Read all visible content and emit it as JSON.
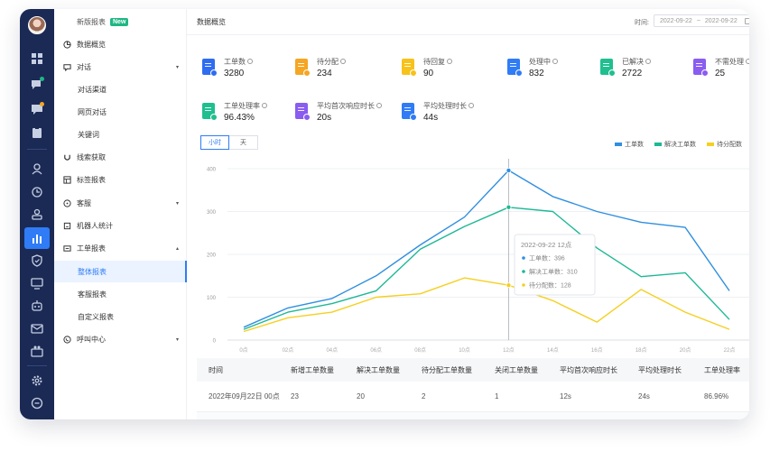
{
  "menu": {
    "report_new": "新版报表",
    "new_badge": "New",
    "items": [
      {
        "label": "数据概览",
        "icon": "pie-chart-icon"
      },
      {
        "label": "对话",
        "icon": "chat-icon",
        "caret": "▾"
      },
      {
        "label": "对话渠道"
      },
      {
        "label": "网页对话"
      },
      {
        "label": "关键词"
      },
      {
        "label": "线索获取",
        "icon": "magnet-icon"
      },
      {
        "label": "标签报表",
        "icon": "tag-table-icon"
      },
      {
        "label": "客服",
        "icon": "headset-icon",
        "caret": "▾"
      },
      {
        "label": "机器人统计",
        "icon": "robot-icon"
      },
      {
        "label": "工单报表",
        "icon": "ticket-icon",
        "caret": "▴"
      },
      {
        "label": "整体报表"
      },
      {
        "label": "客服报表"
      },
      {
        "label": "自定义报表"
      },
      {
        "label": "呼叫中心",
        "icon": "phone-icon",
        "caret": "▾"
      }
    ]
  },
  "header": {
    "title": "数据概览",
    "time_label": "时间:",
    "date_from": "2022-09-22",
    "date_sep": "~",
    "date_to": "2022-09-22"
  },
  "stats": [
    {
      "label": "工单数",
      "value": "3280",
      "color": "#2f6cf0"
    },
    {
      "label": "待分配",
      "value": "234",
      "color": "#f5a623"
    },
    {
      "label": "待回复",
      "value": "90",
      "color": "#f7c21a"
    },
    {
      "label": "处理中",
      "value": "832",
      "color": "#2f7cf6"
    },
    {
      "label": "已解决",
      "value": "2722",
      "color": "#1fbf8f"
    },
    {
      "label": "不需处理",
      "value": "25",
      "color": "#8a5cf0"
    },
    {
      "label": "工单处理率",
      "value": "96.43%",
      "color": "#1fbf8f"
    },
    {
      "label": "平均首次响应时长",
      "value": "20s",
      "color": "#8a5cf0"
    },
    {
      "label": "平均处理时长",
      "value": "44s",
      "color": "#2f7cf6"
    }
  ],
  "toggle": {
    "hour": "小时",
    "day": "天"
  },
  "colors": {
    "accent": "#2f7cf6",
    "series1": "#2f8fe0",
    "series2": "#1db896",
    "series3": "#f5d020"
  },
  "chart_data": {
    "type": "line",
    "x": [
      "0点",
      "02点",
      "04点",
      "06点",
      "08点",
      "10点",
      "12点",
      "14点",
      "16点",
      "18点",
      "20点",
      "22点"
    ],
    "ylim": [
      0,
      400
    ],
    "yticks": [
      0,
      100,
      200,
      300,
      400
    ],
    "legend_position": "top-right",
    "grid": true,
    "series": [
      {
        "name": "工单数",
        "values": [
          30,
          75,
          97,
          150,
          222,
          287,
          396,
          335,
          300,
          275,
          263,
          115
        ]
      },
      {
        "name": "解决工单数",
        "values": [
          25,
          65,
          85,
          115,
          212,
          265,
          310,
          300,
          215,
          148,
          157,
          48
        ]
      },
      {
        "name": "待分配数",
        "values": [
          20,
          52,
          65,
          100,
          108,
          145,
          128,
          92,
          42,
          118,
          65,
          25
        ]
      }
    ],
    "tooltip": {
      "title": "2022-09-22  12点",
      "rows": [
        "工单数：396",
        "解决工单数：310",
        "待分配数：128"
      ]
    }
  },
  "table": {
    "headers": [
      "时间",
      "新增工单数量",
      "解决工单数量",
      "待分配工单数量",
      "关闭工单数量",
      "平均首次响应时长",
      "平均处理时长",
      "工单处理率"
    ],
    "rows": [
      [
        "2022年09月22日 00点",
        "23",
        "20",
        "2",
        "1",
        "12s",
        "24s",
        "86.96%"
      ]
    ]
  }
}
